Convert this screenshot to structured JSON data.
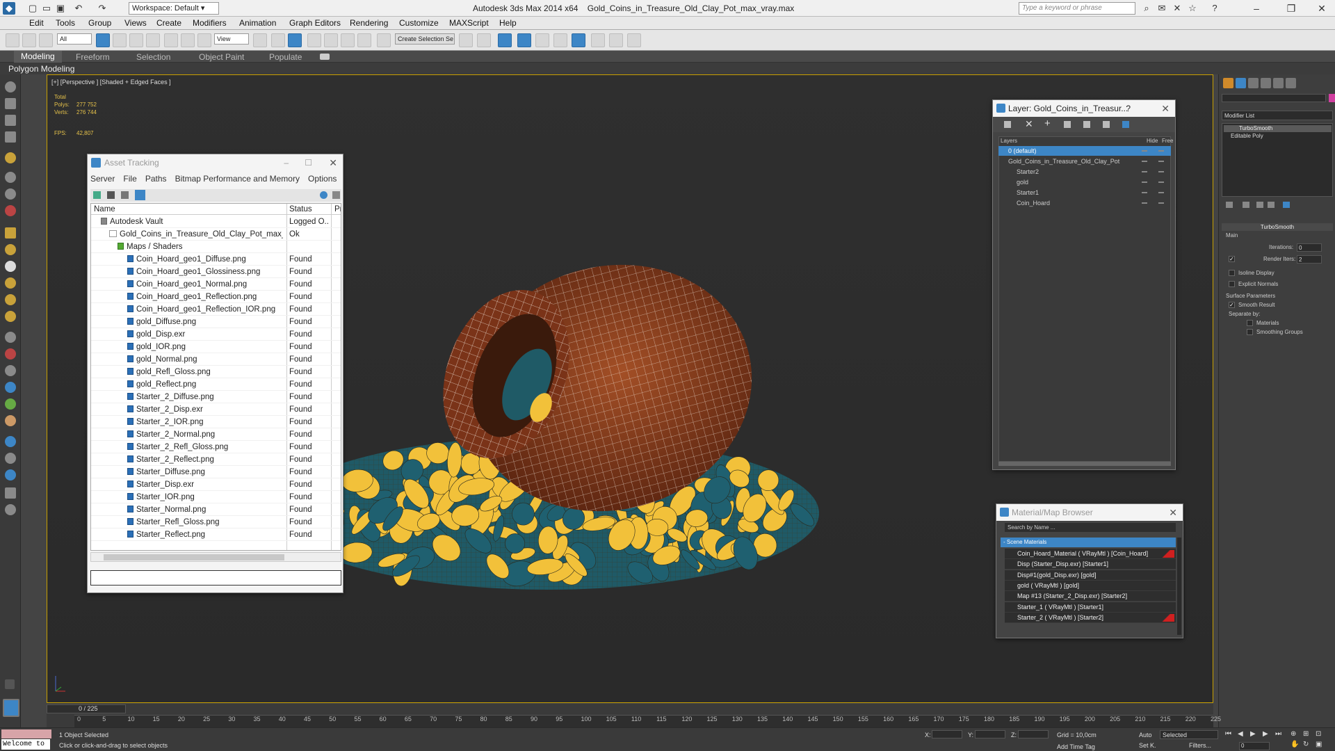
{
  "app": {
    "title": "Autodesk 3ds Max  2014 x64",
    "file": "Gold_Coins_in_Treasure_Old_Clay_Pot_max_vray.max",
    "workspace": "Workspace: Default",
    "search_placeholder": "Type a keyword or phrase"
  },
  "menu": [
    "Edit",
    "Tools",
    "Group",
    "Views",
    "Create",
    "Modifiers",
    "Animation",
    "Graph Editors",
    "Rendering",
    "Customize",
    "MAXScript",
    "Help"
  ],
  "toolbar": {
    "filter": "All",
    "ref_coord": "View",
    "selection_set": "Create Selection Se"
  },
  "ribbon": {
    "tabs": [
      "Modeling",
      "Freeform",
      "Selection",
      "Object Paint",
      "Populate"
    ],
    "subtab": "Polygon Modeling"
  },
  "viewport": {
    "label": "[+] [Perspective ] [Shaded + Edged Faces ]",
    "stats": {
      "total": "Total",
      "polys_label": "Polys:",
      "polys": "277 752",
      "verts_label": "Verts:",
      "verts": "276 744",
      "fps_label": "FPS:",
      "fps": "42,807"
    }
  },
  "asset_tracking": {
    "title": "Asset Tracking",
    "menu": [
      "Server",
      "File",
      "Paths",
      "Bitmap Performance and Memory",
      "Options"
    ],
    "columns": [
      "Name",
      "Status",
      "Pr"
    ],
    "rows": [
      {
        "name": "Autodesk Vault",
        "status": "Logged O...",
        "level": 0
      },
      {
        "name": "Gold_Coins_in_Treasure_Old_Clay_Pot_max_vr...",
        "status": "Ok",
        "level": 1
      },
      {
        "name": "Maps / Shaders",
        "status": "",
        "level": 2
      },
      {
        "name": "Coin_Hoard_geo1_Diffuse.png",
        "status": "Found",
        "level": 3
      },
      {
        "name": "Coin_Hoard_geo1_Glossiness.png",
        "status": "Found",
        "level": 3
      },
      {
        "name": "Coin_Hoard_geo1_Normal.png",
        "status": "Found",
        "level": 3
      },
      {
        "name": "Coin_Hoard_geo1_Reflection.png",
        "status": "Found",
        "level": 3
      },
      {
        "name": "Coin_Hoard_geo1_Reflection_IOR.png",
        "status": "Found",
        "level": 3
      },
      {
        "name": "gold_Diffuse.png",
        "status": "Found",
        "level": 3
      },
      {
        "name": "gold_Disp.exr",
        "status": "Found",
        "level": 3
      },
      {
        "name": "gold_IOR.png",
        "status": "Found",
        "level": 3
      },
      {
        "name": "gold_Normal.png",
        "status": "Found",
        "level": 3
      },
      {
        "name": "gold_Refl_Gloss.png",
        "status": "Found",
        "level": 3
      },
      {
        "name": "gold_Reflect.png",
        "status": "Found",
        "level": 3
      },
      {
        "name": "Starter_2_Diffuse.png",
        "status": "Found",
        "level": 3
      },
      {
        "name": "Starter_2_Disp.exr",
        "status": "Found",
        "level": 3
      },
      {
        "name": "Starter_2_IOR.png",
        "status": "Found",
        "level": 3
      },
      {
        "name": "Starter_2_Normal.png",
        "status": "Found",
        "level": 3
      },
      {
        "name": "Starter_2_Refl_Gloss.png",
        "status": "Found",
        "level": 3
      },
      {
        "name": "Starter_2_Reflect.png",
        "status": "Found",
        "level": 3
      },
      {
        "name": "Starter_Diffuse.png",
        "status": "Found",
        "level": 3
      },
      {
        "name": "Starter_Disp.exr",
        "status": "Found",
        "level": 3
      },
      {
        "name": "Starter_IOR.png",
        "status": "Found",
        "level": 3
      },
      {
        "name": "Starter_Normal.png",
        "status": "Found",
        "level": 3
      },
      {
        "name": "Starter_Refl_Gloss.png",
        "status": "Found",
        "level": 3
      },
      {
        "name": "Starter_Reflect.png",
        "status": "Found",
        "level": 3
      }
    ]
  },
  "layer": {
    "title": "Layer: Gold_Coins_in_Treasur...",
    "columns": [
      "Layers",
      "Hide",
      "Free"
    ],
    "rows": [
      "0 (default)",
      "Gold_Coins_in_Treasure_Old_Clay_Pot",
      "Starter2",
      "gold",
      "Starter1",
      "Coin_Hoard"
    ]
  },
  "material_browser": {
    "title": "Material/Map Browser",
    "search": "Search by Name ...",
    "section": "- Scene Materials",
    "rows": [
      "Coin_Hoard_Material  ( VRayMtl ) [Coin_Hoard]",
      "Disp (Starter_Disp.exr) [Starter1]",
      "Disp#1(gold_Disp.exr) [gold]",
      "gold  ( VRayMtl ) [gold]",
      "Map #13 (Starter_2_Disp.exr) [Starter2]",
      "Starter_1  ( VRayMtl ) [Starter1]",
      "Starter_2  ( VRayMtl ) [Starter2]"
    ]
  },
  "command_panel": {
    "modifier_list": "Modifier List",
    "stack": [
      "TurboSmooth",
      "Editable Poly"
    ],
    "rollout": "TurboSmooth",
    "main": "Main",
    "iterations_label": "Iterations:",
    "iterations": "0",
    "render_iters_label": "Render Iters:",
    "render_iters": "2",
    "isoline": "Isoline Display",
    "explicit_normals": "Explicit Normals",
    "surface_params": "Surface Parameters",
    "smooth_result": "Smooth Result",
    "separate_by": "Separate by:",
    "materials": "Materials",
    "smoothing_groups": "Smoothing Groups"
  },
  "timeline": {
    "frame": "0 / 225",
    "ticks": [
      "0",
      "5",
      "10",
      "15",
      "20",
      "25",
      "30",
      "35",
      "40",
      "45",
      "50",
      "55",
      "60",
      "65",
      "70",
      "75",
      "80",
      "85",
      "90",
      "95",
      "100",
      "105",
      "110",
      "115",
      "120",
      "125",
      "130",
      "135",
      "140",
      "145",
      "150",
      "155",
      "160",
      "165",
      "170",
      "175",
      "180",
      "185",
      "190",
      "195",
      "200",
      "205",
      "210",
      "215",
      "220",
      "225"
    ]
  },
  "status": {
    "welcome": "Welcome to",
    "selected": "1 Object Selected",
    "prompt": "Click or click-and-drag to select objects",
    "x_label": "X:",
    "y_label": "Y:",
    "z_label": "Z:",
    "grid": "Grid = 10,0cm",
    "auto": "Auto",
    "selected_dd": "Selected",
    "set_k": "Set K.",
    "filters": "Filters...",
    "add_time_tag": "Add Time Tag",
    "frame_field": "0"
  },
  "colors": {
    "accent": "#3d86c6",
    "viewport_border": "#c8a000",
    "stats": "#e6c24a",
    "coin": "#f2c13a",
    "pot": "#8a3d1c"
  }
}
